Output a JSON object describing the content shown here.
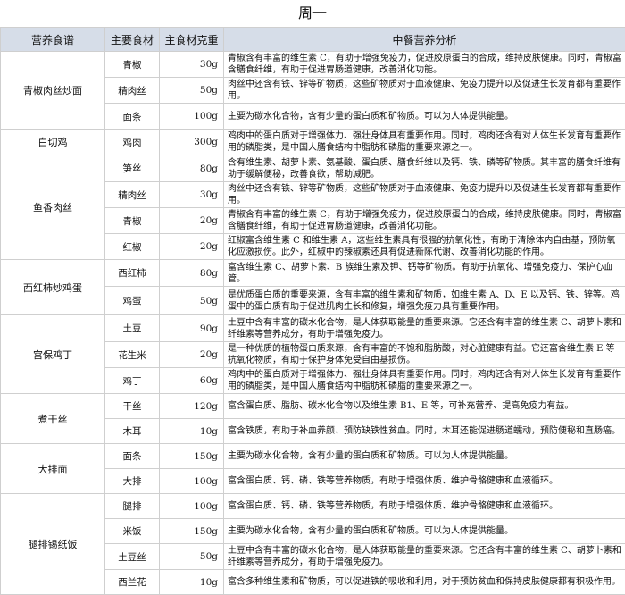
{
  "title": "周一",
  "headers": [
    "营养食谱",
    "主要食材",
    "主食材克重",
    "中餐营养分析"
  ],
  "dishes": [
    {
      "name": "青椒肉丝炒面",
      "rows": [
        {
          "ingredient": "青椒",
          "weight": "30g",
          "analysis": "青椒含有丰富的维生素 C，有助于增强免疫力，促进胶原蛋白的合成，维持皮肤健康。同时，青椒富含膳食纤维，有助于促进胃肠道健康，改善消化功能。"
        },
        {
          "ingredient": "精肉丝",
          "weight": "50g",
          "analysis": "肉丝中还含有铁、锌等矿物质，这些矿物质对于血液健康、免疫力提升以及促进生长发育都有重要作用。"
        },
        {
          "ingredient": "面条",
          "weight": "100g",
          "analysis": "主要为碳水化合物，含有少量的蛋白质和矿物质。可以为人体提供能量。"
        }
      ]
    },
    {
      "name": "白切鸡",
      "rows": [
        {
          "ingredient": "鸡肉",
          "weight": "300g",
          "analysis": "鸡肉中的蛋白质对于增强体力、强壮身体具有重要作用。同时，鸡肉还含有对人体生长发育有重要作用的磷脂类，是中国人膳食结构中脂肪和磷脂的重要来源之一。"
        }
      ]
    },
    {
      "name": "鱼香肉丝",
      "rows": [
        {
          "ingredient": "笋丝",
          "weight": "80g",
          "analysis": "含有维生素、胡萝卜素、氨基酸、蛋白质、膳食纤维以及钙、铁、磷等矿物质。其丰富的膳食纤维有助于缓解便秘，改善食欲，帮助减肥。"
        },
        {
          "ingredient": "精肉丝",
          "weight": "30g",
          "analysis": "肉丝中还含有铁、锌等矿物质，这些矿物质对于血液健康、免疫力提升以及促进生长发育都有重要作用。"
        },
        {
          "ingredient": "青椒",
          "weight": "20g",
          "analysis": "青椒含有丰富的维生素 C，有助于增强免疫力，促进胶原蛋白的合成，维持皮肤健康。同时，青椒富含膳食纤维，有助于促进胃肠道健康，改善消化功能。"
        },
        {
          "ingredient": "红椒",
          "weight": "20g",
          "analysis": "红椒富含维生素 C 和维生素 A，这些维生素具有很强的抗氧化性，有助于清除体内自由基，预防氧化应激损伤。此外，红椒中的辣椒素还具有促进新陈代谢、改善消化功能的作用。"
        }
      ]
    },
    {
      "name": "西红柿炒鸡蛋",
      "rows": [
        {
          "ingredient": "西红柿",
          "weight": "80g",
          "analysis": "富含维生素 C、胡萝卜素、B 族维生素及钾、钙等矿物质。有助于抗氧化、增强免疫力、保护心血管。"
        },
        {
          "ingredient": "鸡蛋",
          "weight": "50g",
          "analysis": "是优质蛋白质的重要来源，含有丰富的维生素和矿物质，如维生素 A、D、E 以及钙、铁、锌等。鸡蛋中的蛋白质有助于促进肌肉生长和修复，增强免疫力具有重要作用。"
        }
      ]
    },
    {
      "name": "宫保鸡丁",
      "rows": [
        {
          "ingredient": "土豆",
          "weight": "90g",
          "analysis": "土豆中含有丰富的碳水化合物，是人体获取能量的重要来源。它还含有丰富的维生素 C、胡萝卜素和纤维素等营养成分，有助于增强免疫力。"
        },
        {
          "ingredient": "花生米",
          "weight": "20g",
          "analysis": "是一种优质的植物蛋白质来源，含有丰富的不饱和脂肪酸，对心脏健康有益。它还富含维生素 E 等抗氧化物质，有助于保护身体免受自由基损伤。"
        },
        {
          "ingredient": "鸡丁",
          "weight": "60g",
          "analysis": "鸡肉中的蛋白质对于增强体力、强壮身体具有重要作用。同时，鸡肉还含有对人体生长发育有重要作用的磷脂类，是中国人膳食结构中脂肪和磷脂的重要来源之一。"
        }
      ]
    },
    {
      "name": "煮干丝",
      "rows": [
        {
          "ingredient": "干丝",
          "weight": "120g",
          "analysis": "富含蛋白质、脂肪、碳水化合物以及维生素 B1、E 等，可补充营养、提高免疫力有益。"
        },
        {
          "ingredient": "木耳",
          "weight": "10g",
          "analysis": "富含铁质，有助于补血养颜、预防缺铁性贫血。同时，木耳还能促进肠道蠕动，预防便秘和直肠癌。"
        }
      ]
    },
    {
      "name": "大排面",
      "rows": [
        {
          "ingredient": "面条",
          "weight": "150g",
          "analysis": "主要为碳水化合物，含有少量的蛋白质和矿物质。可以为人体提供能量。"
        },
        {
          "ingredient": "大排",
          "weight": "100g",
          "analysis": "富含蛋白质、钙、磷、铁等营养物质，有助于增强体质、维护骨骼健康和血液循环。"
        }
      ]
    },
    {
      "name": "腿排锡纸饭",
      "rows": [
        {
          "ingredient": "腿排",
          "weight": "100g",
          "analysis": "富含蛋白质、钙、磷、铁等营养物质，有助于增强体质、维护骨骼健康和血液循环。"
        },
        {
          "ingredient": "米饭",
          "weight": "150g",
          "analysis": "主要为碳水化合物，含有少量的蛋白质和矿物质。可以为人体提供能量。"
        },
        {
          "ingredient": "土豆丝",
          "weight": "50g",
          "analysis": "土豆中含有丰富的碳水化合物，是人体获取能量的重要来源。它还含有丰富的维生素 C、胡萝卜素和纤维素等营养成分，有助于增强免疫力。"
        },
        {
          "ingredient": "西兰花",
          "weight": "10g",
          "analysis": "富含多种维生素和矿物质，可以促进铁的吸收和利用，对于预防贫血和保持皮肤健康都有积极作用。"
        }
      ]
    }
  ]
}
